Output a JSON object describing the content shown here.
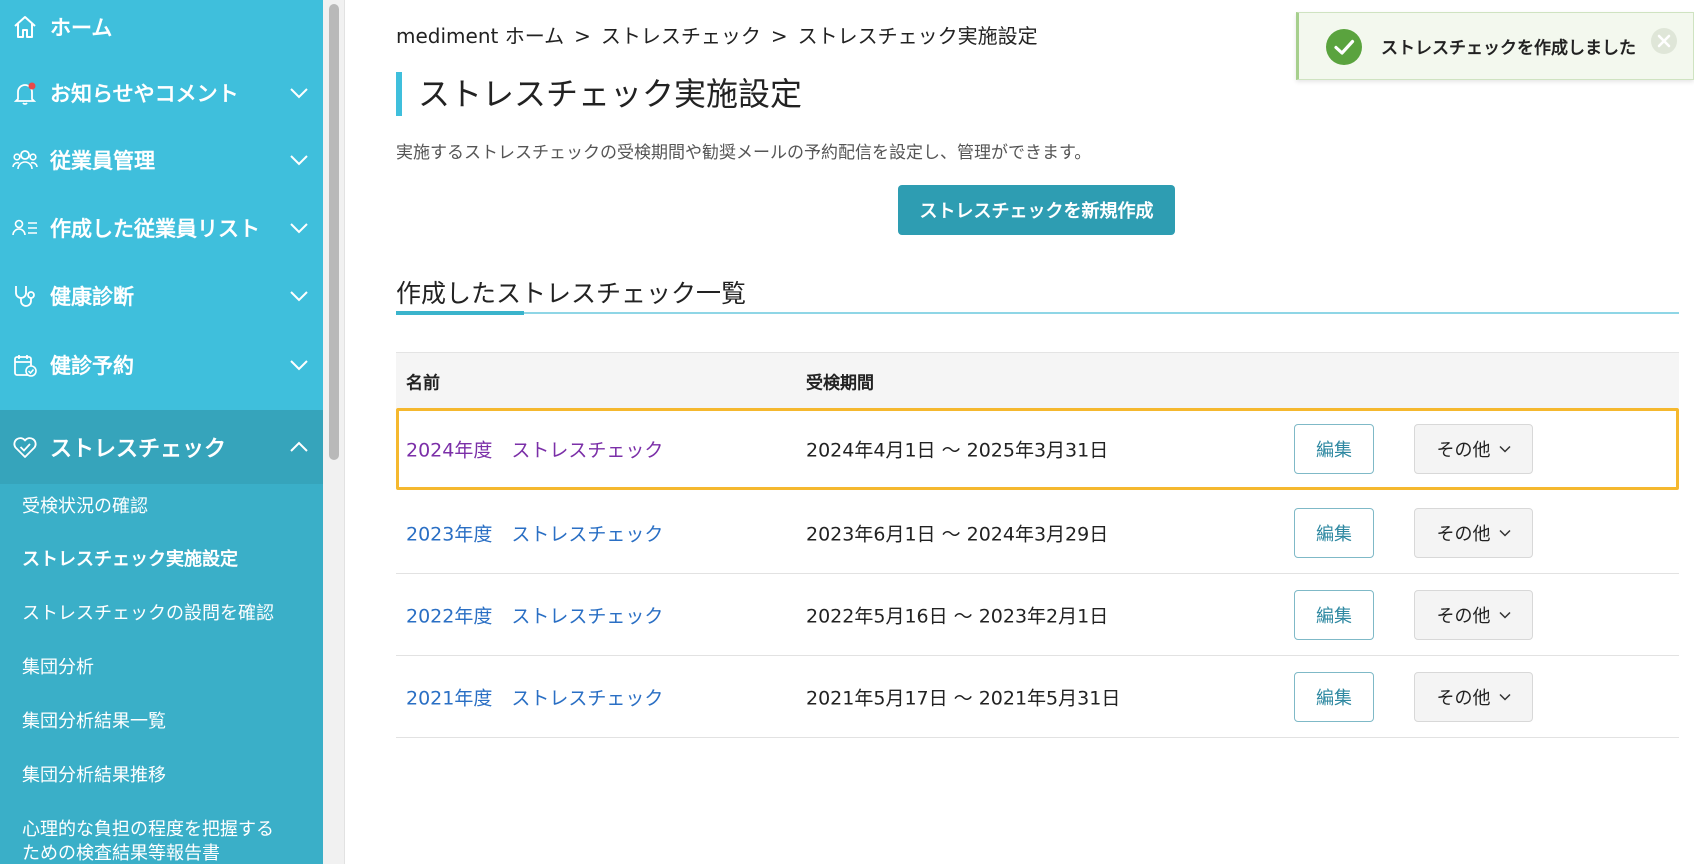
{
  "sidebar": {
    "items": [
      {
        "label": "ホーム",
        "icon": "home-icon"
      },
      {
        "label": "お知らせやコメント",
        "icon": "bell-icon"
      },
      {
        "label": "従業員管理",
        "icon": "people-icon"
      },
      {
        "label": "作成した従業員リスト",
        "icon": "user-list-icon"
      },
      {
        "label": "健康診断",
        "icon": "stethoscope-icon"
      },
      {
        "label": "健診予約",
        "icon": "calendar-check-icon"
      },
      {
        "label": "ストレスチェック",
        "icon": "heart-check-icon",
        "active": true
      }
    ],
    "sub_items": [
      "受検状況の確認",
      "ストレスチェック実施設定",
      "ストレスチェックの設問を確認",
      "集団分析",
      "集団分析結果一覧",
      "集団分析結果推移",
      "心理的な負担の程度を把握する",
      "ための検査結果等報告書"
    ],
    "current_sub_item": "ストレスチェック実施設定",
    "accent_color": "#3fbfdc"
  },
  "breadcrumb": {
    "home": "mediment ホーム",
    "sep": ">",
    "level1": "ストレスチェック",
    "level2": "ストレスチェック実施設定"
  },
  "page": {
    "title": "ストレスチェック実施設定",
    "description": "実施するストレスチェックの受検期間や勧奨メールの予約配信を設定し、管理ができます。",
    "create_button": "ストレスチェックを新規作成"
  },
  "list": {
    "title": "作成したストレスチェック一覧",
    "columns": {
      "name": "名前",
      "period": "受検期間"
    },
    "rows": [
      {
        "name": "2024年度　ストレスチェック",
        "period": "2024年4月1日 〜 2025年3月31日",
        "edit": "編集",
        "other": "その他",
        "highlighted": true
      },
      {
        "name": "2023年度　ストレスチェック",
        "period": "2023年6月1日 〜 2024年3月29日",
        "edit": "編集",
        "other": "その他"
      },
      {
        "name": "2022年度　ストレスチェック",
        "period": "2022年5月16日 〜 2023年2月1日",
        "edit": "編集",
        "other": "その他"
      },
      {
        "name": "2021年度　ストレスチェック",
        "period": "2021年5月17日 〜 2021年5月31日",
        "edit": "編集",
        "other": "その他"
      }
    ]
  },
  "toast": {
    "message": "ストレスチェックを作成しました",
    "icon": "check-circle-icon",
    "close_icon": "close-icon"
  }
}
